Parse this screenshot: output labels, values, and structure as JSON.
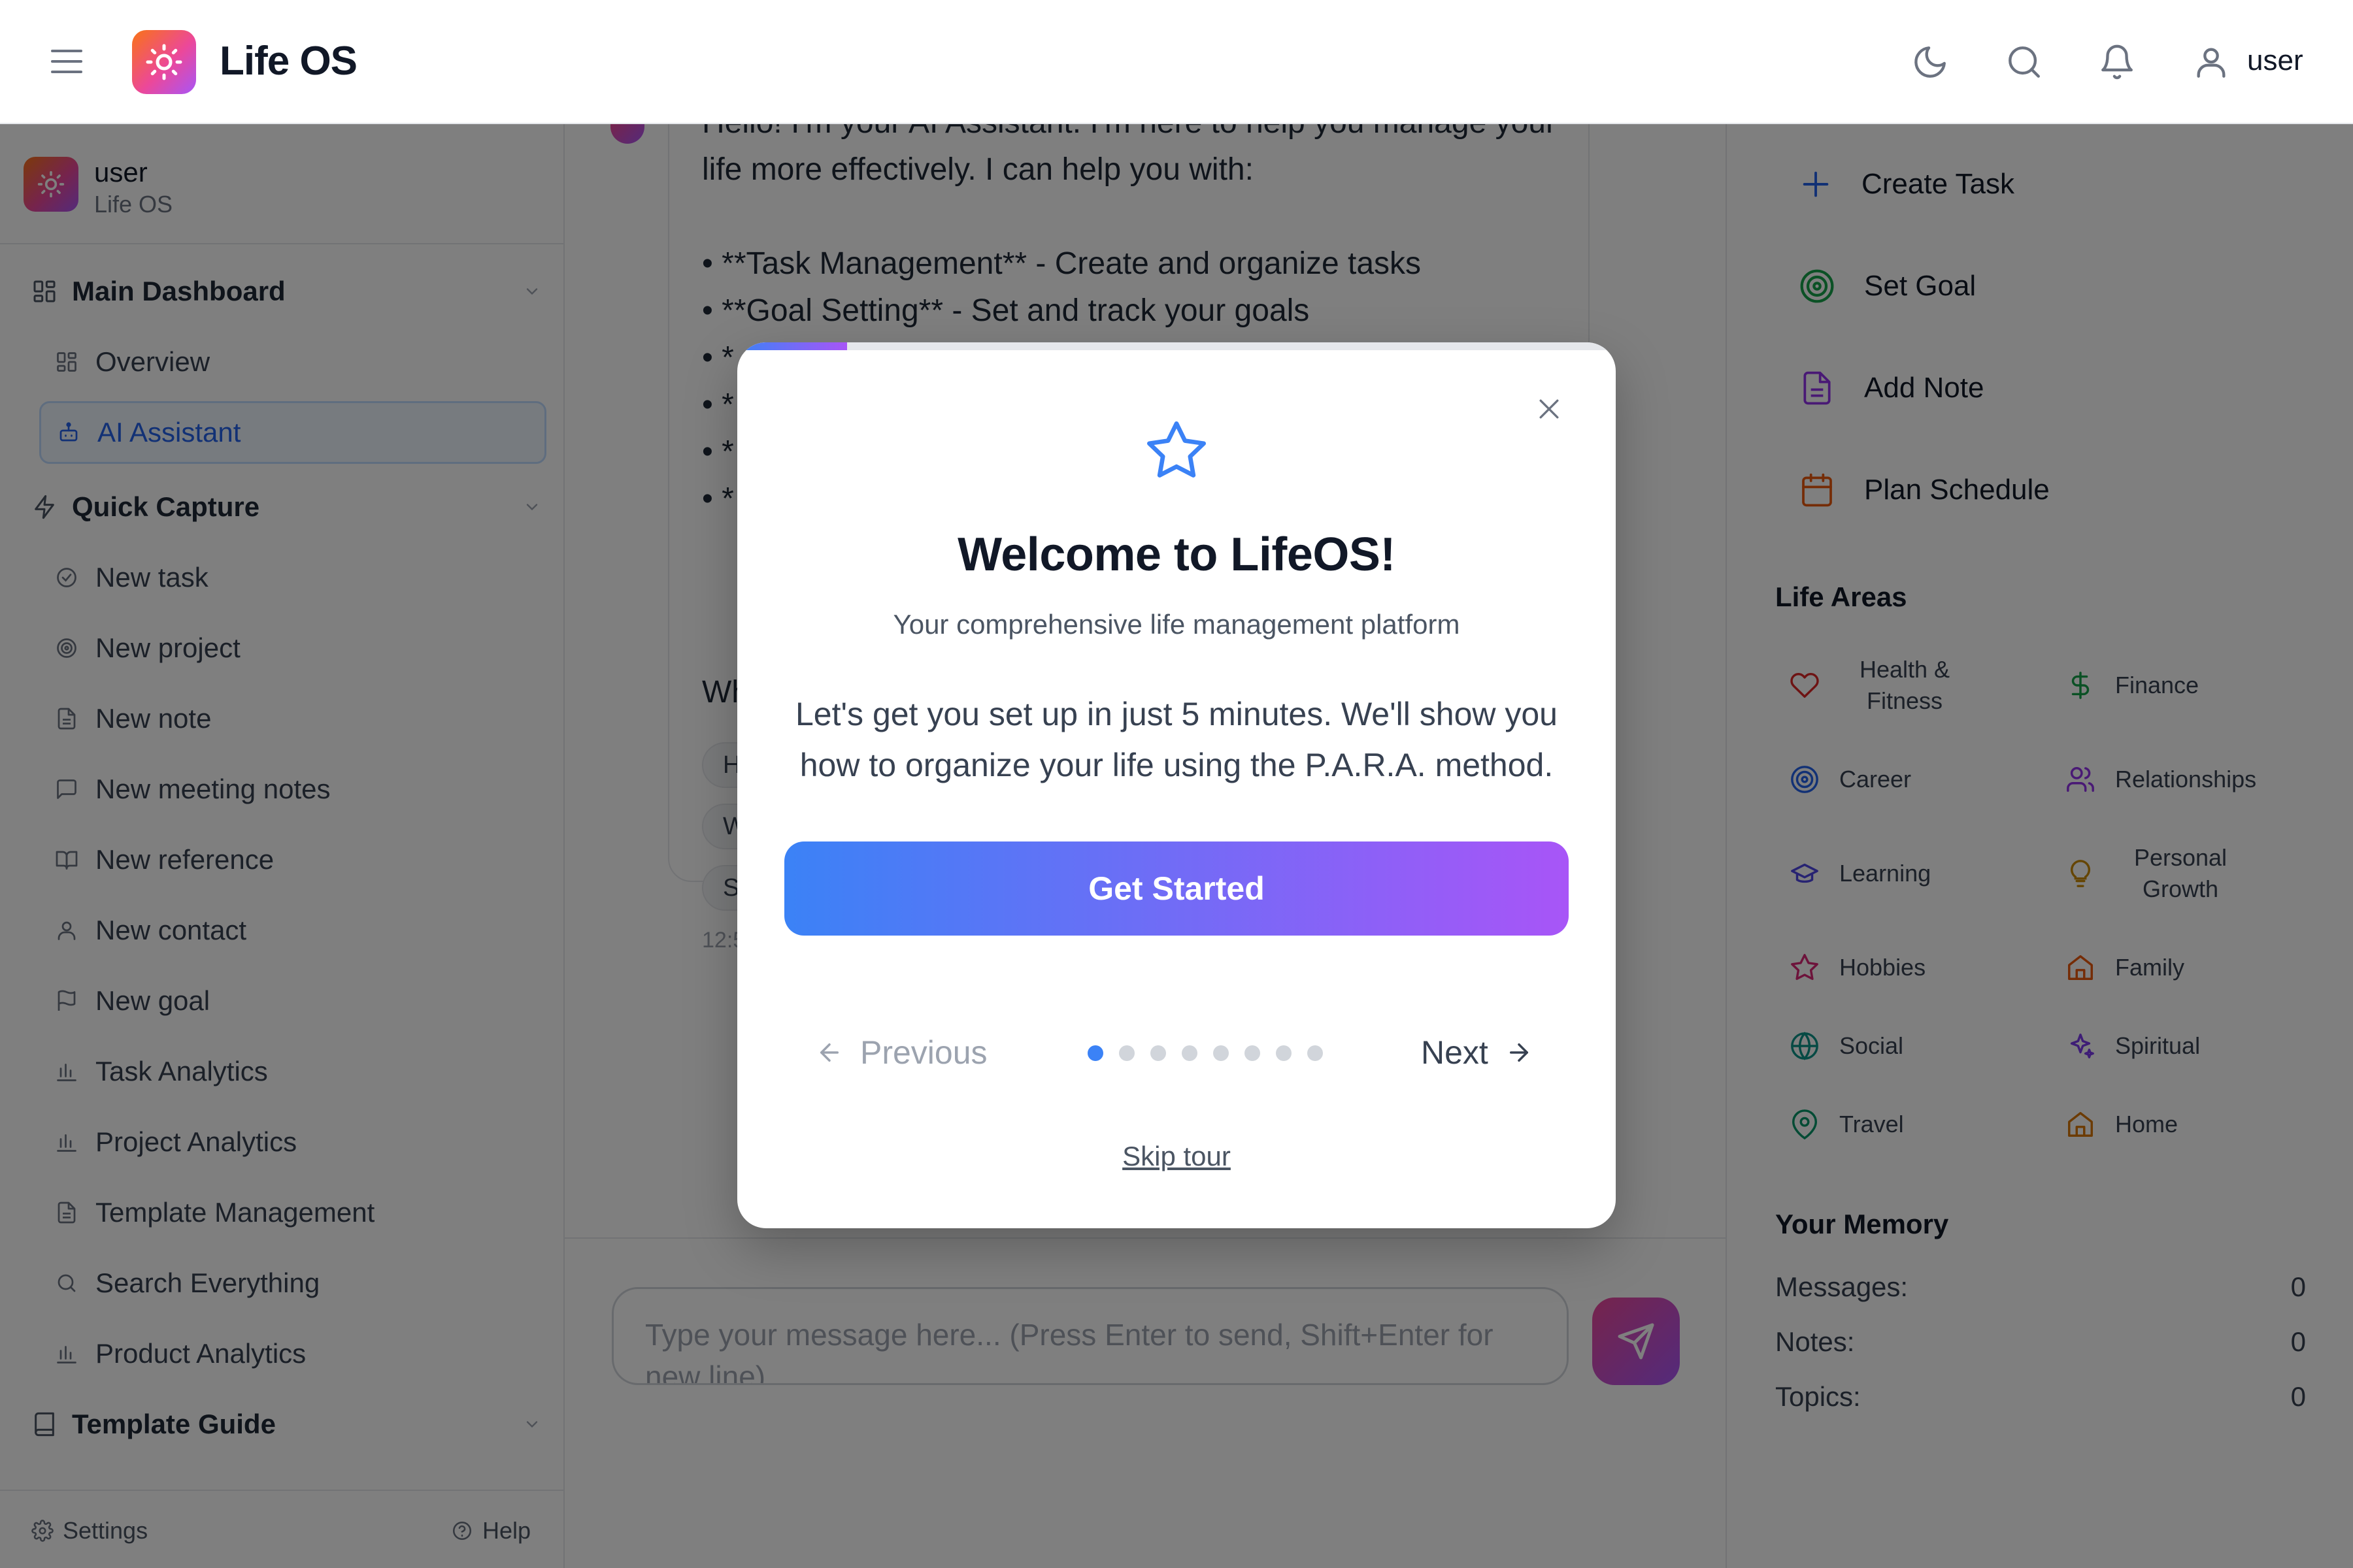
{
  "header": {
    "app_title": "Life OS",
    "user_label": "user",
    "icons": [
      "menu-icon",
      "sun-icon",
      "moon-icon",
      "search-icon",
      "bell-icon",
      "user-icon"
    ]
  },
  "sidebar": {
    "user_name": "user",
    "user_sub": "Life OS",
    "sections": [
      {
        "label": "Main Dashboard",
        "items": [
          {
            "label": "Overview"
          },
          {
            "label": "AI Assistant",
            "active": true
          }
        ]
      },
      {
        "label": "Quick Capture",
        "items": [
          {
            "label": "New task"
          },
          {
            "label": "New project"
          },
          {
            "label": "New note"
          },
          {
            "label": "New meeting notes"
          },
          {
            "label": "New reference"
          },
          {
            "label": "New contact"
          },
          {
            "label": "New goal"
          },
          {
            "label": "Task Analytics"
          },
          {
            "label": "Project Analytics"
          },
          {
            "label": "Template Management"
          },
          {
            "label": "Search Everything"
          },
          {
            "label": "Product Analytics"
          }
        ]
      },
      {
        "label": "Template Guide",
        "items": []
      }
    ],
    "footer": {
      "settings_label": "Settings",
      "help_label": "Help"
    }
  },
  "chat": {
    "message_lines": [
      "Hello! I'm your AI Assistant. I'm here to help you manage your",
      "life more effectively. I can help you with:",
      "",
      "• **Task Management** - Create and organize tasks",
      "• **Goal Setting** - Set and track your goals",
      "• *",
      "• *",
      "• *",
      "• *"
    ],
    "partial_question": "Wh",
    "suggestion_chips": [
      "H",
      "W",
      "S"
    ],
    "timestamp": "12:5",
    "input_placeholder": "Type your message here... (Press Enter to send, Shift+Enter for new line)"
  },
  "right_panel": {
    "quick_actions": [
      {
        "label": "Create Task",
        "icon": "plus-icon",
        "color": "#2563eb"
      },
      {
        "label": "Set Goal",
        "icon": "target-icon",
        "color": "#16a34a"
      },
      {
        "label": "Add Note",
        "icon": "document-icon",
        "color": "#9333ea"
      },
      {
        "label": "Plan Schedule",
        "icon": "calendar-icon",
        "color": "#ea580c"
      }
    ],
    "life_areas_title": "Life Areas",
    "life_areas": [
      {
        "label": "Health & Fitness",
        "icon": "heart-icon",
        "color": "#dc2626"
      },
      {
        "label": "Finance",
        "icon": "dollar-icon",
        "color": "#16a34a"
      },
      {
        "label": "Career",
        "icon": "target-icon",
        "color": "#2563eb"
      },
      {
        "label": "Relationships",
        "icon": "users-icon",
        "color": "#9333ea"
      },
      {
        "label": "Learning",
        "icon": "graduation-cap-icon",
        "color": "#4f46e5"
      },
      {
        "label": "Personal Growth",
        "icon": "lightbulb-icon",
        "color": "#ca8a04"
      },
      {
        "label": "Hobbies",
        "icon": "star-icon",
        "color": "#db2777"
      },
      {
        "label": "Family",
        "icon": "house-icon",
        "color": "#ea580c"
      },
      {
        "label": "Social",
        "icon": "globe-icon",
        "color": "#0d9488"
      },
      {
        "label": "Spiritual",
        "icon": "sparkles-icon",
        "color": "#7c3aed"
      },
      {
        "label": "Travel",
        "icon": "map-pin-icon",
        "color": "#059669"
      },
      {
        "label": "Home",
        "icon": "house-icon",
        "color": "#d97706"
      }
    ],
    "memory_title": "Your Memory",
    "memory": [
      {
        "label": "Messages:",
        "value": "0"
      },
      {
        "label": "Notes:",
        "value": "0"
      },
      {
        "label": "Topics:",
        "value": "0"
      }
    ]
  },
  "modal": {
    "progress_fraction": 0.125,
    "title": "Welcome to LifeOS!",
    "subtitle": "Your comprehensive life management platform",
    "body_lines": [
      "Let's get you set up in just 5 minutes. We'll show you",
      "how to organize your life using the P.A.R.A. method."
    ],
    "cta_label": "Get Started",
    "previous_label": "Previous",
    "next_label": "Next",
    "total_steps": 8,
    "current_step": 1,
    "skip_label": "Skip tour"
  }
}
